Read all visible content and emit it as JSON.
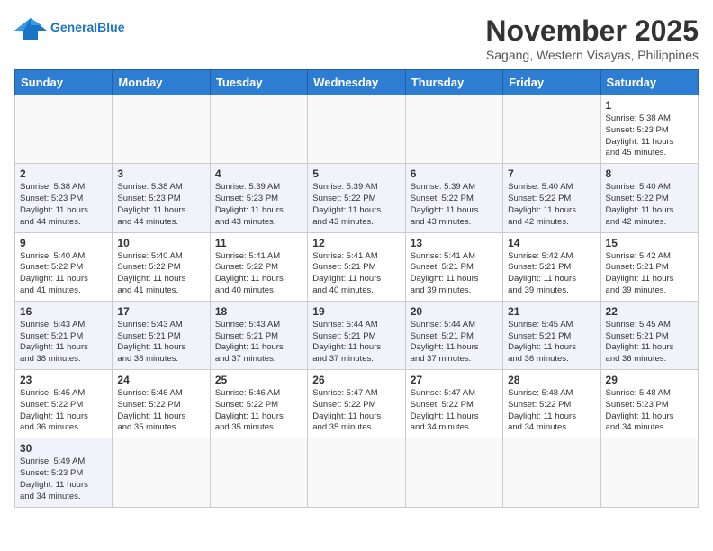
{
  "header": {
    "logo_line1": "General",
    "logo_line2": "Blue",
    "month": "November 2025",
    "location": "Sagang, Western Visayas, Philippines"
  },
  "weekdays": [
    "Sunday",
    "Monday",
    "Tuesday",
    "Wednesday",
    "Thursday",
    "Friday",
    "Saturday"
  ],
  "weeks": [
    [
      {
        "day": "",
        "info": ""
      },
      {
        "day": "",
        "info": ""
      },
      {
        "day": "",
        "info": ""
      },
      {
        "day": "",
        "info": ""
      },
      {
        "day": "",
        "info": ""
      },
      {
        "day": "",
        "info": ""
      },
      {
        "day": "1",
        "info": "Sunrise: 5:38 AM\nSunset: 5:23 PM\nDaylight: 11 hours\nand 45 minutes."
      }
    ],
    [
      {
        "day": "2",
        "info": "Sunrise: 5:38 AM\nSunset: 5:23 PM\nDaylight: 11 hours\nand 44 minutes."
      },
      {
        "day": "3",
        "info": "Sunrise: 5:38 AM\nSunset: 5:23 PM\nDaylight: 11 hours\nand 44 minutes."
      },
      {
        "day": "4",
        "info": "Sunrise: 5:39 AM\nSunset: 5:23 PM\nDaylight: 11 hours\nand 43 minutes."
      },
      {
        "day": "5",
        "info": "Sunrise: 5:39 AM\nSunset: 5:22 PM\nDaylight: 11 hours\nand 43 minutes."
      },
      {
        "day": "6",
        "info": "Sunrise: 5:39 AM\nSunset: 5:22 PM\nDaylight: 11 hours\nand 43 minutes."
      },
      {
        "day": "7",
        "info": "Sunrise: 5:40 AM\nSunset: 5:22 PM\nDaylight: 11 hours\nand 42 minutes."
      },
      {
        "day": "8",
        "info": "Sunrise: 5:40 AM\nSunset: 5:22 PM\nDaylight: 11 hours\nand 42 minutes."
      }
    ],
    [
      {
        "day": "9",
        "info": "Sunrise: 5:40 AM\nSunset: 5:22 PM\nDaylight: 11 hours\nand 41 minutes."
      },
      {
        "day": "10",
        "info": "Sunrise: 5:40 AM\nSunset: 5:22 PM\nDaylight: 11 hours\nand 41 minutes."
      },
      {
        "day": "11",
        "info": "Sunrise: 5:41 AM\nSunset: 5:22 PM\nDaylight: 11 hours\nand 40 minutes."
      },
      {
        "day": "12",
        "info": "Sunrise: 5:41 AM\nSunset: 5:21 PM\nDaylight: 11 hours\nand 40 minutes."
      },
      {
        "day": "13",
        "info": "Sunrise: 5:41 AM\nSunset: 5:21 PM\nDaylight: 11 hours\nand 39 minutes."
      },
      {
        "day": "14",
        "info": "Sunrise: 5:42 AM\nSunset: 5:21 PM\nDaylight: 11 hours\nand 39 minutes."
      },
      {
        "day": "15",
        "info": "Sunrise: 5:42 AM\nSunset: 5:21 PM\nDaylight: 11 hours\nand 39 minutes."
      }
    ],
    [
      {
        "day": "16",
        "info": "Sunrise: 5:43 AM\nSunset: 5:21 PM\nDaylight: 11 hours\nand 38 minutes."
      },
      {
        "day": "17",
        "info": "Sunrise: 5:43 AM\nSunset: 5:21 PM\nDaylight: 11 hours\nand 38 minutes."
      },
      {
        "day": "18",
        "info": "Sunrise: 5:43 AM\nSunset: 5:21 PM\nDaylight: 11 hours\nand 37 minutes."
      },
      {
        "day": "19",
        "info": "Sunrise: 5:44 AM\nSunset: 5:21 PM\nDaylight: 11 hours\nand 37 minutes."
      },
      {
        "day": "20",
        "info": "Sunrise: 5:44 AM\nSunset: 5:21 PM\nDaylight: 11 hours\nand 37 minutes."
      },
      {
        "day": "21",
        "info": "Sunrise: 5:45 AM\nSunset: 5:21 PM\nDaylight: 11 hours\nand 36 minutes."
      },
      {
        "day": "22",
        "info": "Sunrise: 5:45 AM\nSunset: 5:21 PM\nDaylight: 11 hours\nand 36 minutes."
      }
    ],
    [
      {
        "day": "23",
        "info": "Sunrise: 5:45 AM\nSunset: 5:22 PM\nDaylight: 11 hours\nand 36 minutes."
      },
      {
        "day": "24",
        "info": "Sunrise: 5:46 AM\nSunset: 5:22 PM\nDaylight: 11 hours\nand 35 minutes."
      },
      {
        "day": "25",
        "info": "Sunrise: 5:46 AM\nSunset: 5:22 PM\nDaylight: 11 hours\nand 35 minutes."
      },
      {
        "day": "26",
        "info": "Sunrise: 5:47 AM\nSunset: 5:22 PM\nDaylight: 11 hours\nand 35 minutes."
      },
      {
        "day": "27",
        "info": "Sunrise: 5:47 AM\nSunset: 5:22 PM\nDaylight: 11 hours\nand 34 minutes."
      },
      {
        "day": "28",
        "info": "Sunrise: 5:48 AM\nSunset: 5:22 PM\nDaylight: 11 hours\nand 34 minutes."
      },
      {
        "day": "29",
        "info": "Sunrise: 5:48 AM\nSunset: 5:23 PM\nDaylight: 11 hours\nand 34 minutes."
      }
    ],
    [
      {
        "day": "30",
        "info": "Sunrise: 5:49 AM\nSunset: 5:23 PM\nDaylight: 11 hours\nand 34 minutes."
      },
      {
        "day": "",
        "info": ""
      },
      {
        "day": "",
        "info": ""
      },
      {
        "day": "",
        "info": ""
      },
      {
        "day": "",
        "info": ""
      },
      {
        "day": "",
        "info": ""
      },
      {
        "day": "",
        "info": ""
      }
    ]
  ]
}
